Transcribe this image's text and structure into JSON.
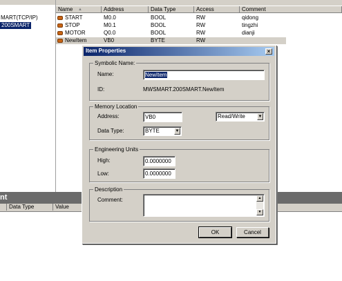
{
  "tree": {
    "nodes": [
      "MART(TCP/IP)",
      "200SMART"
    ]
  },
  "list": {
    "headers": [
      "Name",
      "Address",
      "Data Type",
      "Access",
      "Comment"
    ],
    "sort_indicator": "▲",
    "rows": [
      {
        "name": "START",
        "address": "M0.0",
        "type": "BOOL",
        "access": "RW",
        "comment": "qidong"
      },
      {
        "name": "STOP",
        "address": "M0.1",
        "type": "BOOL",
        "access": "RW",
        "comment": "tingzhi"
      },
      {
        "name": "MOTOR",
        "address": "Q0.0",
        "type": "BOOL",
        "access": "RW",
        "comment": "dianji"
      },
      {
        "name": "NewItem",
        "address": "VB0",
        "type": "BYTE",
        "access": "RW",
        "comment": ""
      }
    ]
  },
  "bottom": {
    "title_fragment": "nt",
    "headers": [
      "Data Type",
      "Value"
    ]
  },
  "dialog": {
    "title": "Item Properties",
    "close_glyph": "×",
    "symbolic": {
      "group_label": "Symbolic Name:",
      "name_label": "Name:",
      "name_value": "NewItem",
      "id_label": "ID:",
      "id_value": "MWSMART.200SMART.NewItem"
    },
    "memory": {
      "group_label": "Memory Location",
      "address_label": "Address:",
      "address_value": "VB0",
      "access_value": "Read/Write",
      "datatype_label": "Data Type:",
      "datatype_value": "BYTE"
    },
    "eng": {
      "group_label": "Engineering Units",
      "high_label": "High:",
      "high_value": "0.0000000",
      "low_label": "Low:",
      "low_value": "0.0000000"
    },
    "desc": {
      "group_label": "Description",
      "comment_label": "Comment:",
      "comment_value": ""
    },
    "ok_label": "OK",
    "cancel_label": "Cancel"
  }
}
